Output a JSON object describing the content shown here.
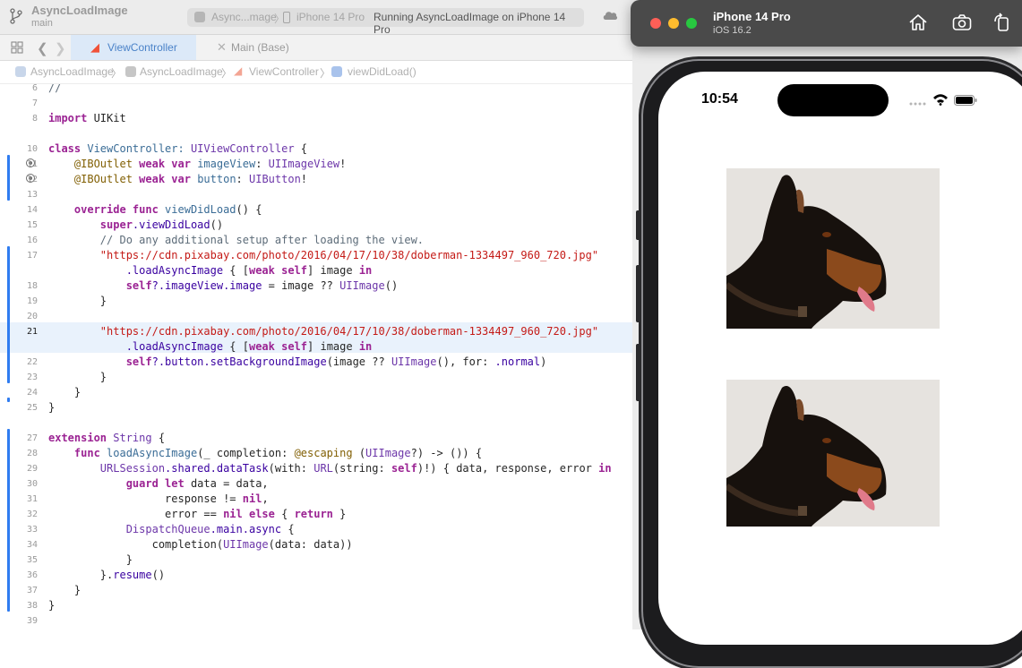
{
  "toolbar": {
    "project_name": "AsyncLoadImage",
    "branch": "main",
    "scheme_name": "Async...mage",
    "scheme_separator": "〉",
    "device": "iPhone 14 Pro",
    "status": "Running AsyncLoadImage on iPhone 14 Pro"
  },
  "tabs": [
    {
      "label": "ViewController",
      "icon": "swift-icon",
      "active": true
    },
    {
      "label": "Main (Base)",
      "icon": "storyboard-icon",
      "active": false
    }
  ],
  "breadcrumb": {
    "items": [
      "AsyncLoadImage",
      "AsyncLoadImage",
      "ViewController",
      "viewDidLoad()"
    ],
    "separator": "〉"
  },
  "editor": {
    "line_numbers": [
      "6",
      "7",
      "8",
      "10",
      "11",
      "12",
      "13",
      "14",
      "15",
      "16",
      "17",
      "18",
      "19",
      "20",
      "21",
      "22",
      "23",
      "24",
      "25",
      "27",
      "28",
      "29",
      "30",
      "31",
      "32",
      "33",
      "34",
      "35",
      "36",
      "37",
      "38",
      "39"
    ],
    "active_line": "21"
  },
  "code": {
    "l6": "//",
    "l8_kw": "import",
    "l8_mod": " UIKit",
    "l10_kw": "class",
    "l10_name": " ViewController: ",
    "l10_super": "UIViewController",
    "l10_end": " {",
    "l11_attr": "@IBOutlet",
    "l11_kw": " weak var",
    "l11_var": " imageView",
    "l11_colon": ": ",
    "l11_type": "UIImageView",
    "l11_end": "!",
    "l12_attr": "@IBOutlet",
    "l12_kw": " weak var",
    "l12_var": " button",
    "l12_colon": ": ",
    "l12_type": "UIButton",
    "l12_end": "!",
    "l14_kw": "override func",
    "l14_name": " viewDidLoad",
    "l14_end": "() {",
    "l15_kw": "super",
    "l15_call": ".viewDidLoad",
    "l15_end": "()",
    "l16": "// Do any additional setup after loading the view.",
    "l17": "\"https://cdn.pixabay.com/photo/2016/04/17/10/38/doberman-1334497_960_720.jpg\"",
    "l17b_call": ".loadAsyncImage",
    "l17b_open": " { [",
    "l17b_kw1": "weak self",
    "l17b_mid": "] image ",
    "l17b_kw2": "in",
    "l18_self": "self",
    "l18_prop": "?.imageView.image",
    "l18_mid": " = image ?? ",
    "l18_type": "UIImage",
    "l18_end": "()",
    "l19": "}",
    "l21": "\"https://cdn.pixabay.com/photo/2016/04/17/10/38/doberman-1334497_960_720.jpg\"",
    "l21b_call": ".loadAsyncImage",
    "l21b_open": " { [",
    "l21b_kw1": "weak self",
    "l21b_mid": "] image ",
    "l21b_kw2": "in",
    "l22_self": "self",
    "l22_call": "?.button.setBackgroundImage",
    "l22_mid": "(image ?? ",
    "l22_type": "UIImage",
    "l22_mid2": "(), for: ",
    "l22_arg": ".normal",
    "l22_end": ")",
    "l23": "}",
    "l24": "}",
    "l25": "}",
    "l27_kw": "extension",
    "l27_type": " String",
    "l27_end": " {",
    "l28_kw": "func",
    "l28_name": " loadAsyncImage",
    "l28_mid": "(_ completion: ",
    "l28_attr": "@escaping",
    "l28_mid2": " (",
    "l28_type": "UIImage",
    "l28_end": "?) -> ()) {",
    "l29_type": "URLSession",
    "l29_prop": ".shared.dataTask",
    "l29_mid": "(with: ",
    "l29_type2": "URL",
    "l29_mid2": "(string: ",
    "l29_kw": "self",
    "l29_mid3": ")!) { data, response, error ",
    "l29_kw2": "in",
    "l30_kw": "guard let",
    "l30_end": " data = data,",
    "l31": "response != ",
    "l31_kw": "nil",
    "l31_end": ",",
    "l32": "error == ",
    "l32_kw": "nil else",
    "l32_mid": " { ",
    "l32_kw2": "return",
    "l32_end": " }",
    "l33_type": "DispatchQueue",
    "l33_prop": ".main.async",
    "l33_end": " {",
    "l34": "completion(",
    "l34_type": "UIImage",
    "l34_end": "(data: data))",
    "l35": "}",
    "l36": "}.",
    "l36_call": "resume",
    "l36_end": "()",
    "l37": "}",
    "l38": "}"
  },
  "simulator": {
    "device": "iPhone 14 Pro",
    "os": "iOS 16.2",
    "time": "10:54"
  },
  "colors": {
    "accent": "#2f7cf0",
    "keyword": "#9b2393",
    "string": "#c41a16",
    "type": "#3a6c96"
  }
}
